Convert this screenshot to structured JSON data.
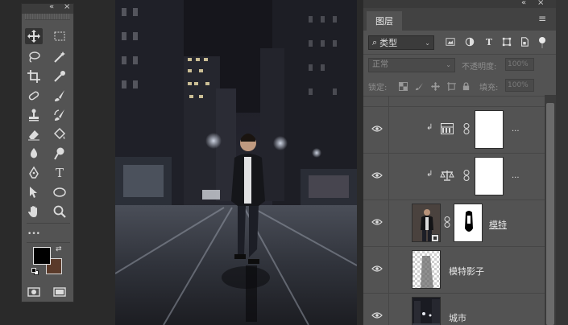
{
  "tools_panel": {
    "collapse_glyph": "«",
    "close_glyph": "×",
    "more_glyph": "•••",
    "type_tool_glyph": "T",
    "foreground_color": "#000000",
    "background_color": "#5a3a2a"
  },
  "layers_panel": {
    "collapse_glyph": "«",
    "close_glyph": "×",
    "tab_label": "图层",
    "menu_glyph": "≡",
    "filter": {
      "label": "类型",
      "search_glyph": "⌕",
      "arrow": "⌄"
    },
    "blend_mode": "正常",
    "opacity_label": "不透明度:",
    "opacity_value": "100%",
    "lock_label": "锁定:",
    "fill_label": "填充:",
    "fill_value": "100%",
    "layers": [
      {
        "name": "",
        "type": "adjustment-curves",
        "dots": "..."
      },
      {
        "name": "",
        "type": "adjustment-balance",
        "dots": "..."
      },
      {
        "name": "模特",
        "type": "smart-object-with-mask"
      },
      {
        "name": "模特影子",
        "type": "pixel"
      },
      {
        "name": "城市",
        "type": "pixel"
      }
    ]
  },
  "colors": {
    "panel_bg": "#535353",
    "dark_bg": "#2a2a2a",
    "tab_bg": "#424242"
  }
}
